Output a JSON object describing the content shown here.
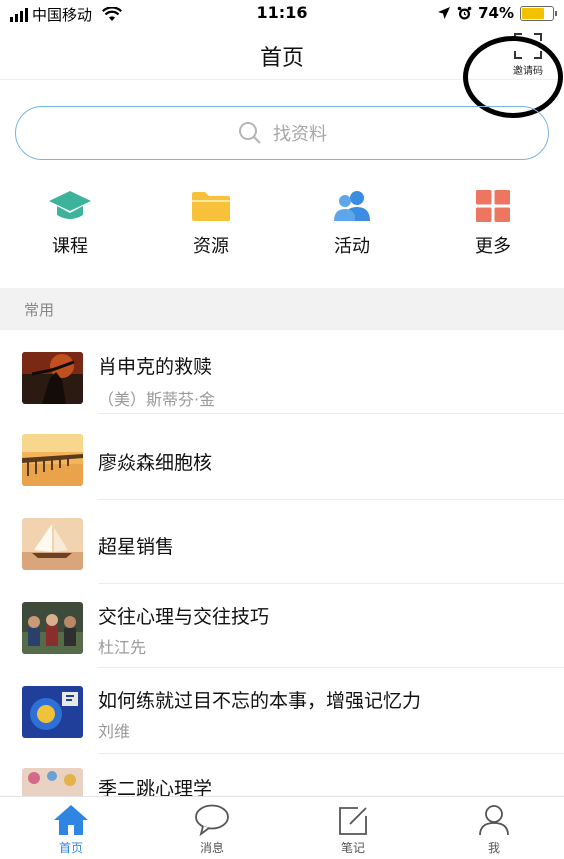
{
  "status_bar": {
    "carrier": "中国移动",
    "time": "11:16",
    "battery": "74%",
    "battery_level": 0.74
  },
  "header": {
    "title": "首页",
    "invite_label": "邀请码",
    "invite_icon": "scan-icon"
  },
  "search": {
    "placeholder": "找资料",
    "icon": "search-icon"
  },
  "quick_menu": [
    {
      "label": "课程",
      "icon": "graduation-cap-icon",
      "color": "#3cb39a"
    },
    {
      "label": "资源",
      "icon": "folder-icon",
      "color": "#f7c23a"
    },
    {
      "label": "活动",
      "icon": "people-icon",
      "color": "#3a8de0"
    },
    {
      "label": "更多",
      "icon": "grid-icon",
      "color": "#ee7560"
    }
  ],
  "section": {
    "label": "常用"
  },
  "items": [
    {
      "title": "肖申克的救赎",
      "subtitle": "（美）斯蒂芬·金"
    },
    {
      "title": "廖焱森细胞核",
      "subtitle": ""
    },
    {
      "title": "超星销售",
      "subtitle": ""
    },
    {
      "title": "交往心理与交往技巧",
      "subtitle": "杜江先"
    },
    {
      "title": "如何练就过目不忘的本事，增强记忆力",
      "subtitle": "刘维"
    },
    {
      "title": "季二跳心理学",
      "subtitle": ""
    }
  ],
  "tabs": [
    {
      "label": "首页",
      "icon": "home-icon",
      "active": true
    },
    {
      "label": "消息",
      "icon": "chat-bubble-icon",
      "active": false
    },
    {
      "label": "笔记",
      "icon": "note-edit-icon",
      "active": false
    },
    {
      "label": "我",
      "icon": "person-icon",
      "active": false
    }
  ],
  "colors": {
    "accent": "#2f86e2",
    "search_border": "#7ab4e3",
    "section_bg": "#f2f2f2"
  }
}
